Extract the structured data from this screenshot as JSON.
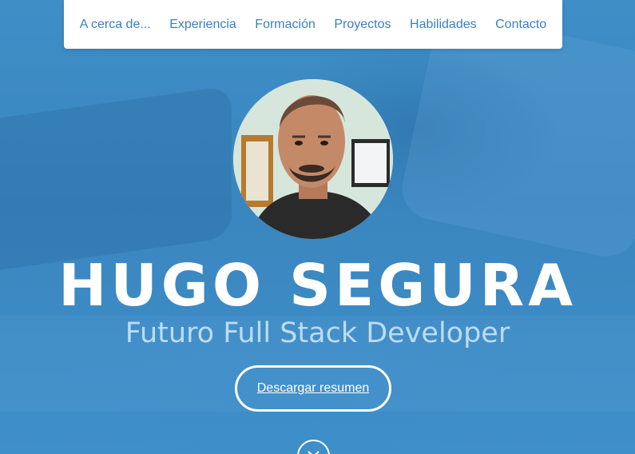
{
  "nav": {
    "items": [
      {
        "label": "A cerca de..."
      },
      {
        "label": "Experiencia"
      },
      {
        "label": "Formación"
      },
      {
        "label": "Proyectos"
      },
      {
        "label": "Habilidades"
      },
      {
        "label": "Contacto"
      }
    ]
  },
  "hero": {
    "name": "HUGO SEGURA",
    "subtitle": "Futuro Full Stack Developer",
    "download_label": "Descargar resumen",
    "scroll_icon": "chevron-down-icon"
  },
  "colors": {
    "background": "#3a85bd",
    "nav_text": "#3c7fc0",
    "subtitle": "#bcdcf7",
    "name": "#ffffff"
  }
}
